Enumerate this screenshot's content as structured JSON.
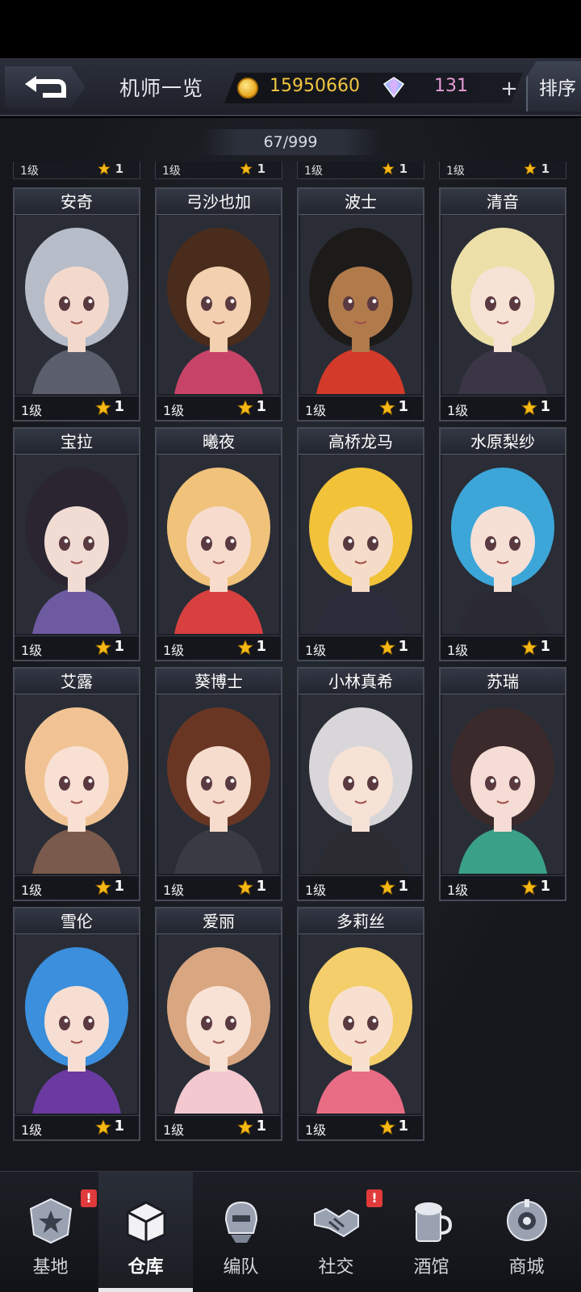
{
  "header": {
    "title": "机师一览",
    "coins": "15950660",
    "gems": "131",
    "plus": "+",
    "sort_label": "排序"
  },
  "count": "67/999",
  "partial_row": [
    {
      "level": "1级",
      "stars": "1"
    },
    {
      "level": "1级",
      "stars": "1"
    },
    {
      "level": "1级",
      "stars": "1"
    },
    {
      "level": "1级",
      "stars": "1"
    }
  ],
  "pilots": [
    {
      "name": "安奇",
      "level": "1级",
      "stars": "1",
      "hair": "#b6bcc8",
      "skin": "#f3d9cc",
      "outfit": "#5b5f6c"
    },
    {
      "name": "弓沙也加",
      "level": "1级",
      "stars": "1",
      "hair": "#4a2c1c",
      "skin": "#f2d0b0",
      "outfit": "#c74468"
    },
    {
      "name": "波士",
      "level": "1级",
      "stars": "1",
      "hair": "#1d1a1a",
      "skin": "#b07a4b",
      "outfit": "#d33a2a"
    },
    {
      "name": "清音",
      "level": "1级",
      "stars": "1",
      "hair": "#ece0a8",
      "skin": "#f7e2d6",
      "outfit": "#3b3645"
    },
    {
      "name": "宝拉",
      "level": "1级",
      "stars": "1",
      "hair": "#2a2530",
      "skin": "#f1dcd4",
      "outfit": "#6e5aa0"
    },
    {
      "name": "曦夜",
      "level": "1级",
      "stars": "1",
      "hair": "#f0c27a",
      "skin": "#f7dccd",
      "outfit": "#d84040"
    },
    {
      "name": "高桥龙马",
      "level": "1级",
      "stars": "1",
      "hair": "#f2c239",
      "skin": "#f5dcc8",
      "outfit": "#2c2d3c"
    },
    {
      "name": "水原梨纱",
      "level": "1级",
      "stars": "1",
      "hair": "#3ca6d8",
      "skin": "#f6e0d6",
      "outfit": "#2b2a33"
    },
    {
      "name": "艾露",
      "level": "1级",
      "stars": "1",
      "hair": "#f1c394",
      "skin": "#f8e0d2",
      "outfit": "#7a5a4c"
    },
    {
      "name": "葵博士",
      "level": "1级",
      "stars": "1",
      "hair": "#6a3624",
      "skin": "#f5dccd",
      "outfit": "#3a3a44"
    },
    {
      "name": "小林真希",
      "level": "1级",
      "stars": "1",
      "hair": "#d8d6d8",
      "skin": "#f7e2d6",
      "outfit": "#2c2b32"
    },
    {
      "name": "苏瑞",
      "level": "1级",
      "stars": "1",
      "hair": "#3a2a2c",
      "skin": "#f5dcd4",
      "outfit": "#3aa088"
    },
    {
      "name": "雪伦",
      "level": "1级",
      "stars": "1",
      "hair": "#3b8fdc",
      "skin": "#f6ded2",
      "outfit": "#6a3aa0"
    },
    {
      "name": "爱丽",
      "level": "1级",
      "stars": "1",
      "hair": "#d8a680",
      "skin": "#f8e2d6",
      "outfit": "#f3c8d0"
    },
    {
      "name": "多莉丝",
      "level": "1级",
      "stars": "1",
      "hair": "#f4ce6a",
      "skin": "#f8e0d0",
      "outfit": "#e86c84"
    }
  ],
  "nav": [
    {
      "label": "基地",
      "icon": "base-icon",
      "badge": "!"
    },
    {
      "label": "仓库",
      "icon": "warehouse-icon",
      "badge": ""
    },
    {
      "label": "编队",
      "icon": "team-icon",
      "badge": ""
    },
    {
      "label": "社交",
      "icon": "handshake-icon",
      "badge": "!"
    },
    {
      "label": "酒馆",
      "icon": "tavern-icon",
      "badge": ""
    },
    {
      "label": "商城",
      "icon": "shop-icon",
      "badge": ""
    }
  ],
  "colors": {
    "coin": "#f2c63f",
    "gem": "#e79bd7",
    "badge": "#e03a3a",
    "star": "#f5b814"
  }
}
